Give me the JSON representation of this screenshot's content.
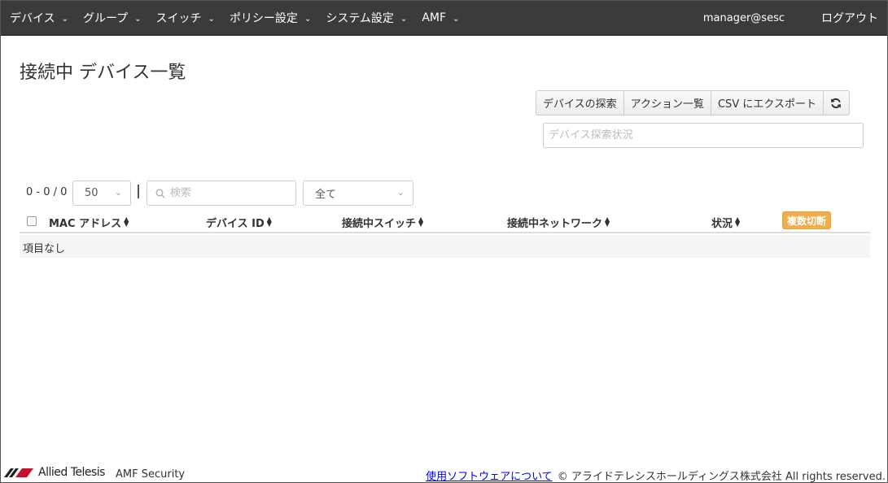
{
  "nav": {
    "items": [
      {
        "label": "デバイス"
      },
      {
        "label": "グループ"
      },
      {
        "label": "スイッチ"
      },
      {
        "label": "ポリシー設定"
      },
      {
        "label": "システム設定"
      },
      {
        "label": "AMF"
      }
    ],
    "user": "manager@sesc",
    "logout": "ログアウト"
  },
  "page": {
    "title": "接続中 デバイス一覧"
  },
  "actions": {
    "discover": "デバイスの探索",
    "action_list": "アクション一覧",
    "csv_export": "CSV にエクスポート",
    "refresh_icon": "refresh-icon"
  },
  "status_field": {
    "placeholder": "デバイス探索状況",
    "value": ""
  },
  "controls": {
    "count": "0 - 0 / 0",
    "page_size": "50",
    "search_placeholder": "検索",
    "filter": "全て"
  },
  "table": {
    "columns": [
      {
        "label": "MAC アドレス"
      },
      {
        "label": "デバイス ID"
      },
      {
        "label": "接続中スイッチ"
      },
      {
        "label": "接続中ネットワーク"
      },
      {
        "label": "状況"
      }
    ],
    "multi_disconnect": "複数切断",
    "empty": "項目なし"
  },
  "footer": {
    "brand": "Allied Telesis",
    "product": "AMF Security",
    "link": "使用ソフトウェアについて",
    "copyright": "© アライドテレシスホールディングス株式会社 All rights reserved."
  },
  "colors": {
    "navbar": "#3b3b3b",
    "accent_button": "#f0ad4e"
  }
}
